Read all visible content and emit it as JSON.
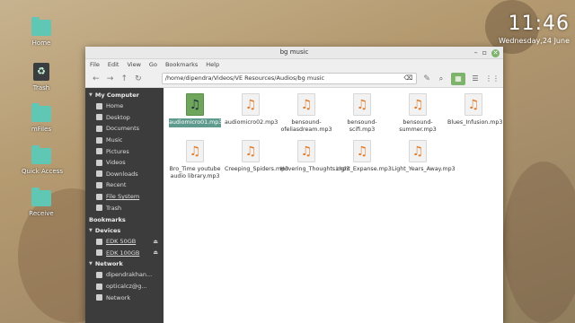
{
  "desktop": {
    "icons": [
      {
        "label": "Home",
        "icon": "folder-icon"
      },
      {
        "label": "Trash",
        "icon": "trash-icon"
      },
      {
        "label": "mFiles",
        "icon": "folder-icon"
      },
      {
        "label": "Quick Access",
        "icon": "folder-icon"
      },
      {
        "label": "Receive",
        "icon": "folder-icon"
      }
    ]
  },
  "clock": {
    "time": "11:46",
    "date": "Wednesday,24 June"
  },
  "window": {
    "title": "bg music",
    "menu": [
      "File",
      "Edit",
      "View",
      "Go",
      "Bookmarks",
      "Help"
    ],
    "path": "/home/dipendra/Videos/VE Resources/Audios/bg music"
  },
  "sidebar": {
    "my_computer": {
      "header": "My Computer",
      "items": [
        "Home",
        "Desktop",
        "Documents",
        "Music",
        "Pictures",
        "Videos",
        "Downloads",
        "Recent",
        "File System",
        "Trash"
      ]
    },
    "bookmarks": {
      "header": "Bookmarks"
    },
    "devices": {
      "header": "Devices",
      "items": [
        "EDK 50GB",
        "EDK 100GB"
      ]
    },
    "network": {
      "header": "Network",
      "items": [
        "dipendrakhan...",
        "opticalcz@g...",
        "Network"
      ]
    }
  },
  "files": [
    {
      "name": "audiomicro01.mp3",
      "selected": true
    },
    {
      "name": "audiomicro02.mp3"
    },
    {
      "name": "bensound-ofeliasdream.mp3"
    },
    {
      "name": "bensound-scifi.mp3"
    },
    {
      "name": "bensound-summer.mp3"
    },
    {
      "name": "Blues_Infusion.mp3"
    },
    {
      "name": "Bro_Time youtube audio library.mp3"
    },
    {
      "name": "Creeping_Spiders.mp3"
    },
    {
      "name": "Hovering_Thoughts.mp3"
    },
    {
      "name": "Light_Expanse.mp3"
    },
    {
      "name": "Light_Years_Away.mp3"
    }
  ],
  "colors": {
    "accent": "#7db36b",
    "selection": "#5f9a8e",
    "sidebar": "#3c3c3c"
  }
}
